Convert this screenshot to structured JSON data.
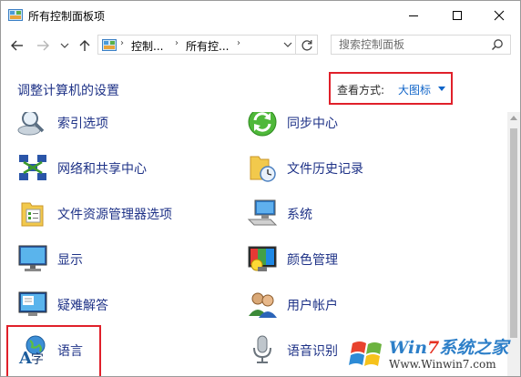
{
  "window": {
    "title": "所有控制面板项"
  },
  "address": {
    "crumbs": [
      "控制...",
      "所有控...",
      ""
    ],
    "search_placeholder": "搜索控制面板"
  },
  "header": {
    "title": "调整计算机的设置",
    "view_label": "查看方式:",
    "view_value": "大图标"
  },
  "items": [
    {
      "label": "索引选项",
      "icon": "indexing-options-icon"
    },
    {
      "label": "同步中心",
      "icon": "sync-center-icon"
    },
    {
      "label": "网络和共享中心",
      "icon": "network-icon"
    },
    {
      "label": "文件历史记录",
      "icon": "file-history-icon"
    },
    {
      "label": "文件资源管理器选项",
      "icon": "folder-options-icon"
    },
    {
      "label": "系统",
      "icon": "system-icon"
    },
    {
      "label": "显示",
      "icon": "display-icon"
    },
    {
      "label": "颜色管理",
      "icon": "color-management-icon"
    },
    {
      "label": "疑难解答",
      "icon": "troubleshooting-icon"
    },
    {
      "label": "用户帐户",
      "icon": "user-accounts-icon"
    },
    {
      "label": "语言",
      "icon": "language-icon"
    },
    {
      "label": "语音识别",
      "icon": "speech-recognition-icon"
    }
  ],
  "watermark": {
    "brand_prefix": "Win",
    "brand_seven": "7",
    "brand_suffix": "系统之家",
    "url": "Www.Winwin7.com"
  },
  "colors": {
    "link": "#1e3287",
    "accent": "#0f64c8",
    "highlight": "#e0202a"
  }
}
